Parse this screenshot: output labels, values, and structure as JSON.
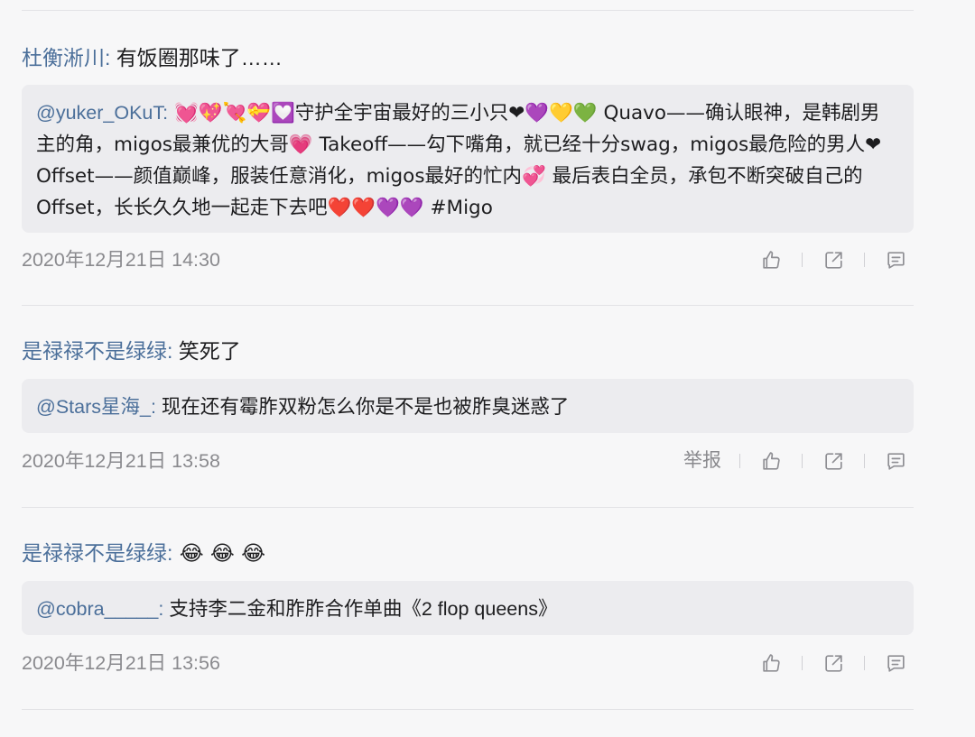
{
  "comments": [
    {
      "author": "杜衡淅川:",
      "text": " 有饭圈那味了……",
      "quote_author": "@yuker_OKuT:",
      "quote_text": " 💓💖💘💝💟守护全宇宙最好的三小只❤💜💛💚 Quavo——确认眼神，是韩剧男主的角，migos最兼优的大哥💗 Takeoff——勾下嘴角，就已经十分swag，migos最危险的男人❤ Offset——颜值巅峰，服装任意消化，migos最好的忙内💞 最后表白全员，承包不断突破自己的Offset，长长久久地一起走下去吧❤️❤️💜💜 #Migo",
      "time": "2020年12月21日 14:30"
    },
    {
      "author": "是禄禄不是绿绿:",
      "text": " 笑死了",
      "quote_author": "@Stars星海_:",
      "quote_text": " 现在还有霉胙双粉怎么你是不是也被胙臭迷惑了",
      "time": "2020年12月21日 13:58",
      "report_label": "举报"
    },
    {
      "author": "是禄禄不是绿绿:",
      "text": " 😂 😂 😂",
      "quote_author": "@cobra_____:",
      "quote_text": " 支持李二金和胙胙合作单曲《2 flop queens》",
      "time": "2020年12月21日 13:56"
    }
  ],
  "icons": {
    "like": "thumbs-up-icon",
    "share": "share-icon",
    "reply": "comment-icon"
  },
  "colors": {
    "author": "#4b6f9a",
    "quote_bg": "#ececef",
    "meta": "#8a8a8e"
  }
}
